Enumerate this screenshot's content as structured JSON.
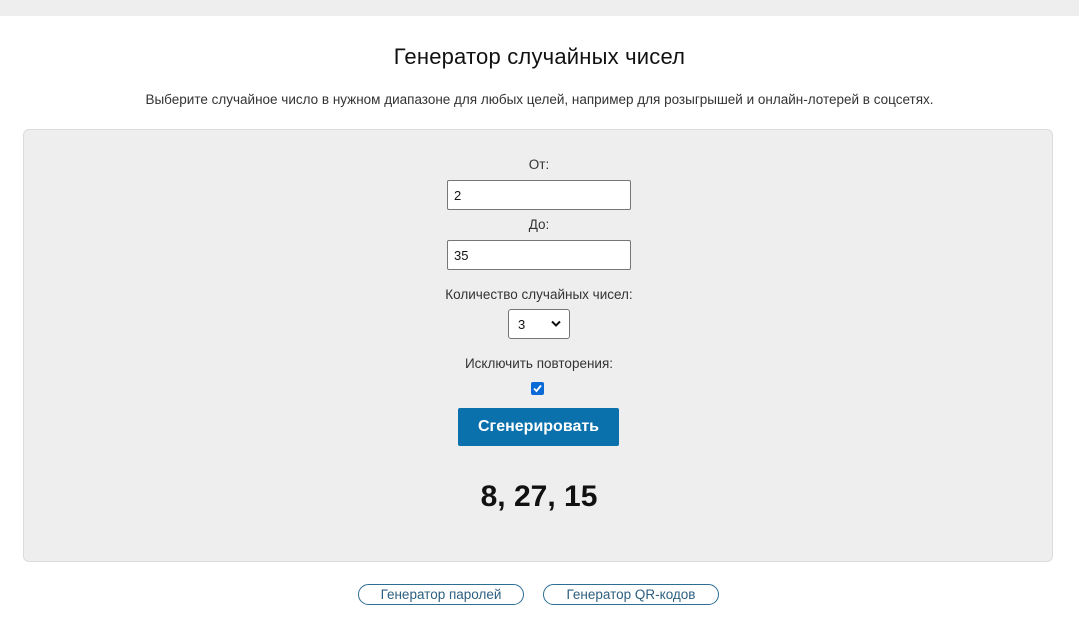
{
  "page": {
    "title": "Генератор случайных чисел",
    "subtitle": "Выберите случайное число в нужном диапазоне для любых целей, например для розыгрышей и онлайн-лотерей в соцсетях."
  },
  "form": {
    "from_label": "От:",
    "from_value": "2",
    "to_label": "До:",
    "to_value": "35",
    "count_label": "Количество случайных чисел:",
    "count_value": "3",
    "exclude_label": "Исключить повторения:",
    "exclude_checked": true,
    "button_label": "Сгенерировать"
  },
  "result": {
    "numbers": "8, 27, 15"
  },
  "links": {
    "password_generator": "Генератор паролей",
    "qr_generator": "Генератор QR-кодов"
  },
  "colors": {
    "accent": "#0a71ad",
    "panel_bg": "#eeeeee",
    "checkbox": "#0b6ad6",
    "link_border": "#2d6d94"
  },
  "icons": {
    "select_chevron": "chevron-down-icon",
    "checkbox_mark": "check-icon"
  }
}
